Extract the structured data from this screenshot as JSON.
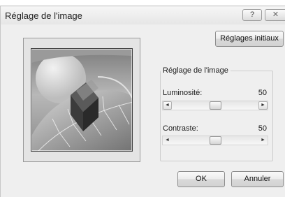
{
  "dialog": {
    "title": "Réglage de l'image",
    "help_label": "?",
    "close_label": "✕",
    "reset_label": "Réglages initiaux",
    "ok_label": "OK",
    "cancel_label": "Annuler"
  },
  "adjust_group": {
    "title": "Réglage de l'image",
    "brightness": {
      "label": "Luminosité:",
      "value": "50",
      "level": 50
    },
    "contrast": {
      "label": "Contraste:",
      "value": "50",
      "level": 50
    }
  },
  "icons": {
    "scroll_left": "◄",
    "scroll_right": "►"
  }
}
